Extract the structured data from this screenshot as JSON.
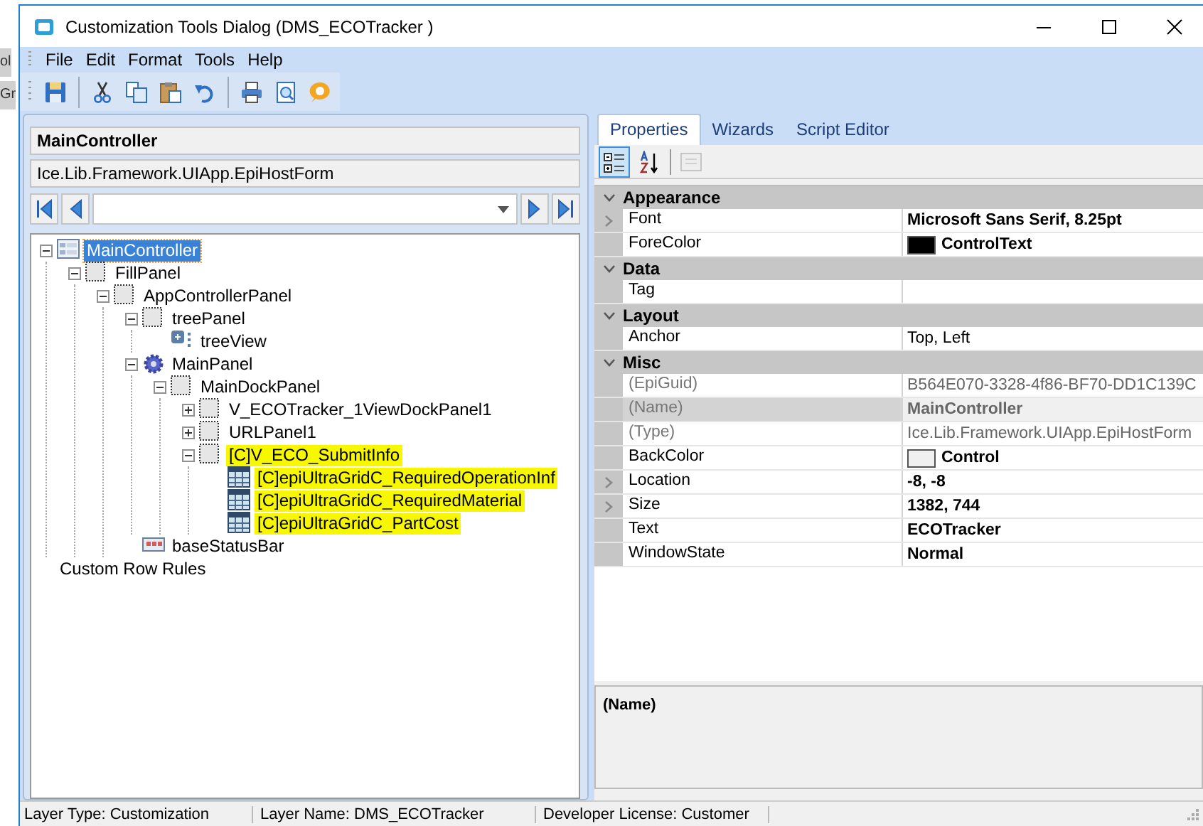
{
  "background_window": {
    "texts": [
      "ol",
      "Gr"
    ]
  },
  "window": {
    "title": "Customization Tools Dialog  (DMS_ECOTracker )"
  },
  "menu": [
    "File",
    "Edit",
    "Format",
    "Tools",
    "Help"
  ],
  "toolbar": [
    {
      "kind": "save"
    },
    {
      "kind": "sep"
    },
    {
      "kind": "cut"
    },
    {
      "kind": "copy"
    },
    {
      "kind": "paste"
    },
    {
      "kind": "undo"
    },
    {
      "kind": "sep"
    },
    {
      "kind": "print"
    },
    {
      "kind": "preview"
    },
    {
      "kind": "help"
    }
  ],
  "left_panel": {
    "control_name": "MainController",
    "control_type": "Ice.Lib.Framework.UIApp.EpiHostForm",
    "tree": [
      {
        "label": "MainController",
        "kind": "form",
        "expanded": true,
        "selected": true,
        "highlighted": false,
        "children": [
          {
            "label": "FillPanel",
            "kind": "panel",
            "expanded": true,
            "selected": false,
            "highlighted": false,
            "children": [
              {
                "label": "AppControllerPanel",
                "kind": "panel",
                "expanded": true,
                "selected": false,
                "highlighted": false,
                "children": [
                  {
                    "label": "treePanel",
                    "kind": "panel",
                    "expanded": true,
                    "selected": false,
                    "highlighted": false,
                    "children": [
                      {
                        "label": "treeView",
                        "kind": "treeview",
                        "selected": false,
                        "highlighted": false
                      }
                    ]
                  },
                  {
                    "label": "MainPanel",
                    "kind": "gear",
                    "expanded": true,
                    "selected": false,
                    "highlighted": false,
                    "children": [
                      {
                        "label": "MainDockPanel",
                        "kind": "panel",
                        "expanded": true,
                        "selected": false,
                        "highlighted": false,
                        "children": [
                          {
                            "label": "V_ECOTracker_1ViewDockPanel1",
                            "kind": "panel",
                            "expanded": false,
                            "selected": false,
                            "highlighted": false
                          },
                          {
                            "label": "URLPanel1",
                            "kind": "panel",
                            "expanded": false,
                            "selected": false,
                            "highlighted": false
                          },
                          {
                            "label": "[C]V_ECO_SubmitInfo",
                            "kind": "panel",
                            "expanded": true,
                            "selected": false,
                            "highlighted": true,
                            "children": [
                              {
                                "label": "[C]epiUltraGridC_RequiredOperationInf",
                                "kind": "grid",
                                "selected": false,
                                "highlighted": true
                              },
                              {
                                "label": "[C]epiUltraGridC_RequiredMaterial",
                                "kind": "grid",
                                "selected": false,
                                "highlighted": true
                              },
                              {
                                "label": "[C]epiUltraGridC_PartCost",
                                "kind": "grid",
                                "selected": false,
                                "highlighted": true
                              }
                            ]
                          }
                        ]
                      }
                    ]
                  },
                  {
                    "label": "baseStatusBar",
                    "kind": "statusbar",
                    "selected": false,
                    "highlighted": false
                  }
                ]
              }
            ]
          }
        ]
      },
      {
        "label": "Custom Row Rules",
        "kind": "rules",
        "selected": false,
        "highlighted": false
      }
    ]
  },
  "tabs": [
    {
      "label": "Properties",
      "selected": true
    },
    {
      "label": "Wizards",
      "selected": false
    },
    {
      "label": "Script Editor",
      "selected": false
    }
  ],
  "grid_toolbar": [
    {
      "kind": "categorized",
      "selected": true,
      "disabled": false
    },
    {
      "kind": "alphabetical",
      "selected": false,
      "disabled": false
    },
    {
      "kind": "pages",
      "selected": false,
      "disabled": true
    }
  ],
  "properties": [
    {
      "category": "Appearance",
      "rows": [
        {
          "name": "Font",
          "value": "Microsoft Sans Serif, 8.25pt",
          "expandable": true,
          "bold": true,
          "readonly": false
        },
        {
          "name": "ForeColor",
          "value": "ControlText",
          "color": "#000000",
          "expandable": false,
          "bold": true,
          "readonly": false
        }
      ]
    },
    {
      "category": "Data",
      "rows": [
        {
          "name": "Tag",
          "expandable": false,
          "readonly": false
        }
      ]
    },
    {
      "category": "Layout",
      "rows": [
        {
          "name": "Anchor",
          "value": "Top, Left",
          "expandable": false,
          "bold": false,
          "readonly": false
        }
      ]
    },
    {
      "category": "Misc",
      "rows": [
        {
          "name": "(EpiGuid)",
          "value": "B564E070-3328-4f86-BF70-DD1C139C",
          "expandable": false,
          "bold": false,
          "readonly": true
        },
        {
          "name": "(Name)",
          "value": "MainController",
          "expandable": false,
          "bold": true,
          "readonly": true,
          "selected": true
        },
        {
          "name": "(Type)",
          "value": "Ice.Lib.Framework.UIApp.EpiHostForm",
          "expandable": false,
          "bold": false,
          "readonly": true
        },
        {
          "name": "BackColor",
          "value": "Control",
          "color": "#f0f0f0",
          "expandable": false,
          "bold": true,
          "readonly": false
        },
        {
          "name": "Location",
          "value": "-8, -8",
          "expandable": true,
          "bold": true,
          "readonly": false
        },
        {
          "name": "Size",
          "value": "1382, 744",
          "expandable": true,
          "bold": true,
          "readonly": false
        },
        {
          "name": "Text",
          "value": "ECOTracker",
          "expandable": false,
          "bold": true,
          "readonly": false
        },
        {
          "name": "WindowState",
          "value": "Normal",
          "expandable": false,
          "bold": true,
          "readonly": false
        }
      ]
    }
  ],
  "description": {
    "title": "(Name)"
  },
  "status_bar": [
    "Layer Type:  Customization",
    "Layer Name:  DMS_ECOTracker",
    "Developer License:  Customer"
  ]
}
